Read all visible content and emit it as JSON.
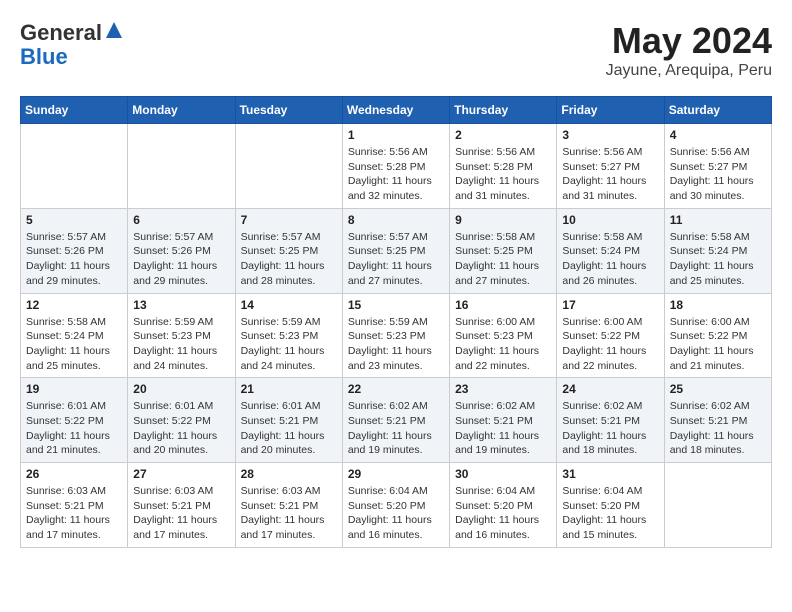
{
  "header": {
    "logo_line1": "General",
    "logo_line2": "Blue",
    "title": "May 2024",
    "subtitle": "Jayune, Arequipa, Peru"
  },
  "days_of_week": [
    "Sunday",
    "Monday",
    "Tuesday",
    "Wednesday",
    "Thursday",
    "Friday",
    "Saturday"
  ],
  "weeks": [
    [
      {
        "day": "",
        "info": ""
      },
      {
        "day": "",
        "info": ""
      },
      {
        "day": "",
        "info": ""
      },
      {
        "day": "1",
        "info": "Sunrise: 5:56 AM\nSunset: 5:28 PM\nDaylight: 11 hours\nand 32 minutes."
      },
      {
        "day": "2",
        "info": "Sunrise: 5:56 AM\nSunset: 5:28 PM\nDaylight: 11 hours\nand 31 minutes."
      },
      {
        "day": "3",
        "info": "Sunrise: 5:56 AM\nSunset: 5:27 PM\nDaylight: 11 hours\nand 31 minutes."
      },
      {
        "day": "4",
        "info": "Sunrise: 5:56 AM\nSunset: 5:27 PM\nDaylight: 11 hours\nand 30 minutes."
      }
    ],
    [
      {
        "day": "5",
        "info": "Sunrise: 5:57 AM\nSunset: 5:26 PM\nDaylight: 11 hours\nand 29 minutes."
      },
      {
        "day": "6",
        "info": "Sunrise: 5:57 AM\nSunset: 5:26 PM\nDaylight: 11 hours\nand 29 minutes."
      },
      {
        "day": "7",
        "info": "Sunrise: 5:57 AM\nSunset: 5:25 PM\nDaylight: 11 hours\nand 28 minutes."
      },
      {
        "day": "8",
        "info": "Sunrise: 5:57 AM\nSunset: 5:25 PM\nDaylight: 11 hours\nand 27 minutes."
      },
      {
        "day": "9",
        "info": "Sunrise: 5:58 AM\nSunset: 5:25 PM\nDaylight: 11 hours\nand 27 minutes."
      },
      {
        "day": "10",
        "info": "Sunrise: 5:58 AM\nSunset: 5:24 PM\nDaylight: 11 hours\nand 26 minutes."
      },
      {
        "day": "11",
        "info": "Sunrise: 5:58 AM\nSunset: 5:24 PM\nDaylight: 11 hours\nand 25 minutes."
      }
    ],
    [
      {
        "day": "12",
        "info": "Sunrise: 5:58 AM\nSunset: 5:24 PM\nDaylight: 11 hours\nand 25 minutes."
      },
      {
        "day": "13",
        "info": "Sunrise: 5:59 AM\nSunset: 5:23 PM\nDaylight: 11 hours\nand 24 minutes."
      },
      {
        "day": "14",
        "info": "Sunrise: 5:59 AM\nSunset: 5:23 PM\nDaylight: 11 hours\nand 24 minutes."
      },
      {
        "day": "15",
        "info": "Sunrise: 5:59 AM\nSunset: 5:23 PM\nDaylight: 11 hours\nand 23 minutes."
      },
      {
        "day": "16",
        "info": "Sunrise: 6:00 AM\nSunset: 5:23 PM\nDaylight: 11 hours\nand 22 minutes."
      },
      {
        "day": "17",
        "info": "Sunrise: 6:00 AM\nSunset: 5:22 PM\nDaylight: 11 hours\nand 22 minutes."
      },
      {
        "day": "18",
        "info": "Sunrise: 6:00 AM\nSunset: 5:22 PM\nDaylight: 11 hours\nand 21 minutes."
      }
    ],
    [
      {
        "day": "19",
        "info": "Sunrise: 6:01 AM\nSunset: 5:22 PM\nDaylight: 11 hours\nand 21 minutes."
      },
      {
        "day": "20",
        "info": "Sunrise: 6:01 AM\nSunset: 5:22 PM\nDaylight: 11 hours\nand 20 minutes."
      },
      {
        "day": "21",
        "info": "Sunrise: 6:01 AM\nSunset: 5:21 PM\nDaylight: 11 hours\nand 20 minutes."
      },
      {
        "day": "22",
        "info": "Sunrise: 6:02 AM\nSunset: 5:21 PM\nDaylight: 11 hours\nand 19 minutes."
      },
      {
        "day": "23",
        "info": "Sunrise: 6:02 AM\nSunset: 5:21 PM\nDaylight: 11 hours\nand 19 minutes."
      },
      {
        "day": "24",
        "info": "Sunrise: 6:02 AM\nSunset: 5:21 PM\nDaylight: 11 hours\nand 18 minutes."
      },
      {
        "day": "25",
        "info": "Sunrise: 6:02 AM\nSunset: 5:21 PM\nDaylight: 11 hours\nand 18 minutes."
      }
    ],
    [
      {
        "day": "26",
        "info": "Sunrise: 6:03 AM\nSunset: 5:21 PM\nDaylight: 11 hours\nand 17 minutes."
      },
      {
        "day": "27",
        "info": "Sunrise: 6:03 AM\nSunset: 5:21 PM\nDaylight: 11 hours\nand 17 minutes."
      },
      {
        "day": "28",
        "info": "Sunrise: 6:03 AM\nSunset: 5:21 PM\nDaylight: 11 hours\nand 17 minutes."
      },
      {
        "day": "29",
        "info": "Sunrise: 6:04 AM\nSunset: 5:20 PM\nDaylight: 11 hours\nand 16 minutes."
      },
      {
        "day": "30",
        "info": "Sunrise: 6:04 AM\nSunset: 5:20 PM\nDaylight: 11 hours\nand 16 minutes."
      },
      {
        "day": "31",
        "info": "Sunrise: 6:04 AM\nSunset: 5:20 PM\nDaylight: 11 hours\nand 15 minutes."
      },
      {
        "day": "",
        "info": ""
      }
    ]
  ]
}
